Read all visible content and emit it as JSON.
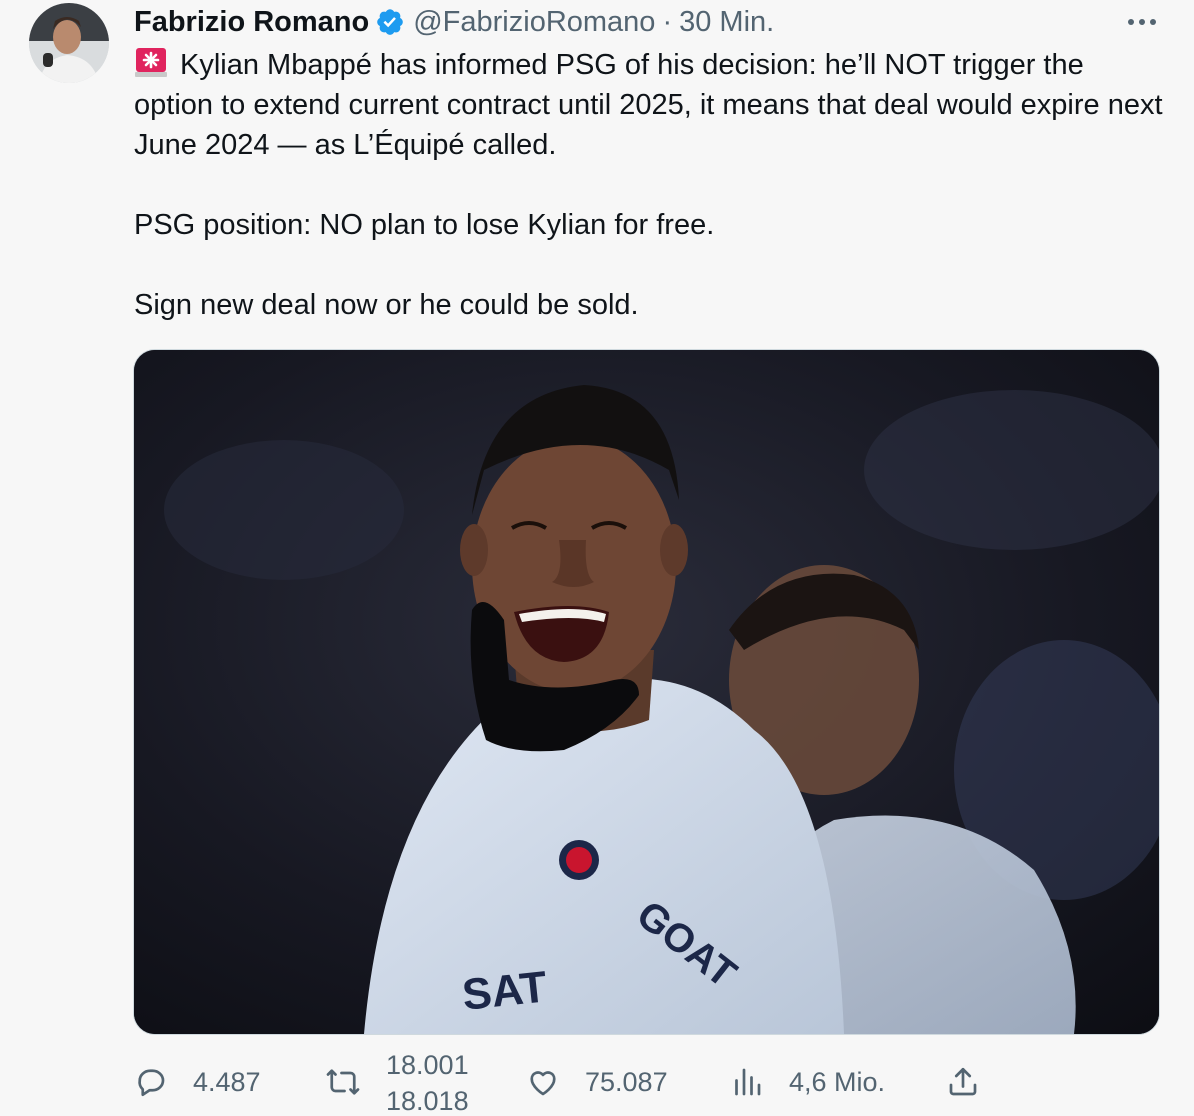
{
  "author": {
    "name": "Fabrizio Romano",
    "handle": "@FabrizioRomano",
    "separator": "·",
    "time": "30 Min.",
    "verified": true
  },
  "tweet": {
    "emoji": "rotating-light-icon",
    "line1": "Kylian Mbappé has informed PSG of his decision: he’ll NOT trigger the option to extend current contract until 2025, it means that deal would expire next June 2024 — as L’Équipé called.",
    "line2": "PSG position: NO plan to lose Kylian for free.",
    "line3": "Sign new deal now or he could be sold."
  },
  "media": {
    "jersey_text": "GOAT",
    "sponsor_text": "SAT"
  },
  "actions": {
    "replies": "4.487",
    "retweets_old": "18.001",
    "retweets_new": "18.018",
    "likes": "75.087",
    "views": "4,6 Mio."
  },
  "colors": {
    "background": "#f7f7f7",
    "text": "#0f1419",
    "secondary": "#536471",
    "verified": "#1d9bf0"
  }
}
